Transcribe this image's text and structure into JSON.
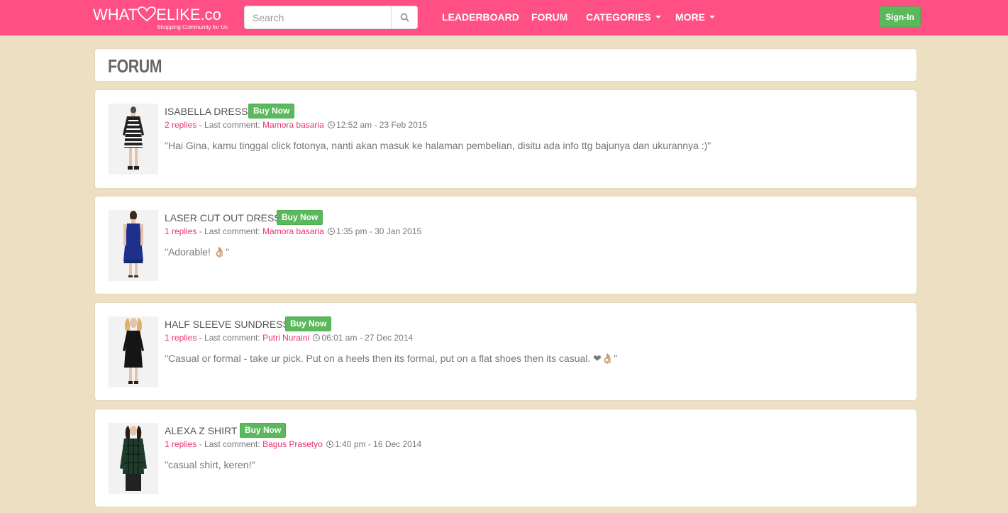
{
  "brand": {
    "logo_left": "WHAT",
    "logo_right": "ELIKE.co",
    "tagline": "Shopping Community for Us",
    "accent_color": "#ff4f85"
  },
  "search": {
    "placeholder": "Search",
    "value": "",
    "icon": "search-icon"
  },
  "nav": {
    "leaderboard": "LEADERBOARD",
    "forum": "FORUM",
    "categories": "CATEGORIES",
    "more": "MORE"
  },
  "signin_label": "Sign-In",
  "page_title": "FORUM",
  "posts": [
    {
      "title": "ISABELLA DRESS",
      "buy_label": "Buy Now",
      "replies": "2 replies",
      "sep": " - Last comment: ",
      "commenter": "Mamora basaria",
      "time": "12:52 am - 23 Feb 2015",
      "comment": "\"Hai Gina, kamu tinggal click fotonya, nanti akan masuk ke halaman pembelian, disitu ada info ttg bajunya dan ukurannya :)\""
    },
    {
      "title": "LASER CUT OUT DRESS",
      "buy_label": "Buy Now",
      "replies": "1 replies",
      "sep": " - Last comment: ",
      "commenter": "Mamora basaria",
      "time": "1:35 pm - 30 Jan 2015",
      "comment": "\"Adorable! 👌🏼\""
    },
    {
      "title": "HALF SLEEVE SUNDRESS",
      "buy_label": "Buy Now",
      "replies": "1 replies",
      "sep": " - Last comment: ",
      "commenter": "Putri Nuraini",
      "time": "06:01 am - 27 Dec 2014",
      "comment": "\"Casual or formal - take ur pick. Put on a heels then its formal, put on a flat shoes then its casual. ❤👌🏼\""
    },
    {
      "title": "ALEXA Z SHIRT",
      "buy_label": "Buy Now",
      "replies": "1 replies",
      "sep": " - Last comment: ",
      "commenter": "Bagus Prasetyo",
      "time": "1:40 pm - 16 Dec 2014",
      "comment": "\"casual shirt, keren!\""
    }
  ]
}
